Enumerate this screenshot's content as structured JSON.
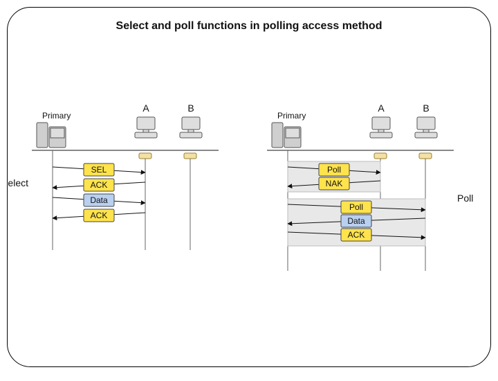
{
  "title": "Select and poll functions in polling access method",
  "left": {
    "caption": "Select",
    "primary_label": "Primary",
    "stations": [
      "A",
      "B"
    ],
    "messages": [
      {
        "label": "SEL",
        "style": "yellow",
        "dir": "right"
      },
      {
        "label": "ACK",
        "style": "yellow",
        "dir": "left"
      },
      {
        "label": "Data",
        "style": "blue",
        "dir": "right"
      },
      {
        "label": "ACK",
        "style": "yellow",
        "dir": "left"
      }
    ]
  },
  "right": {
    "caption": "Poll",
    "primary_label": "Primary",
    "stations": [
      "A",
      "B"
    ],
    "groups": [
      {
        "messages": [
          {
            "label": "Poll",
            "style": "yellow",
            "dir": "right"
          },
          {
            "label": "NAK",
            "style": "yellow",
            "dir": "left"
          }
        ]
      },
      {
        "messages": [
          {
            "label": "Poll",
            "style": "yellow",
            "dir": "right"
          },
          {
            "label": "Data",
            "style": "blue",
            "dir": "left"
          },
          {
            "label": "ACK",
            "style": "yellow",
            "dir": "right"
          }
        ]
      }
    ]
  }
}
